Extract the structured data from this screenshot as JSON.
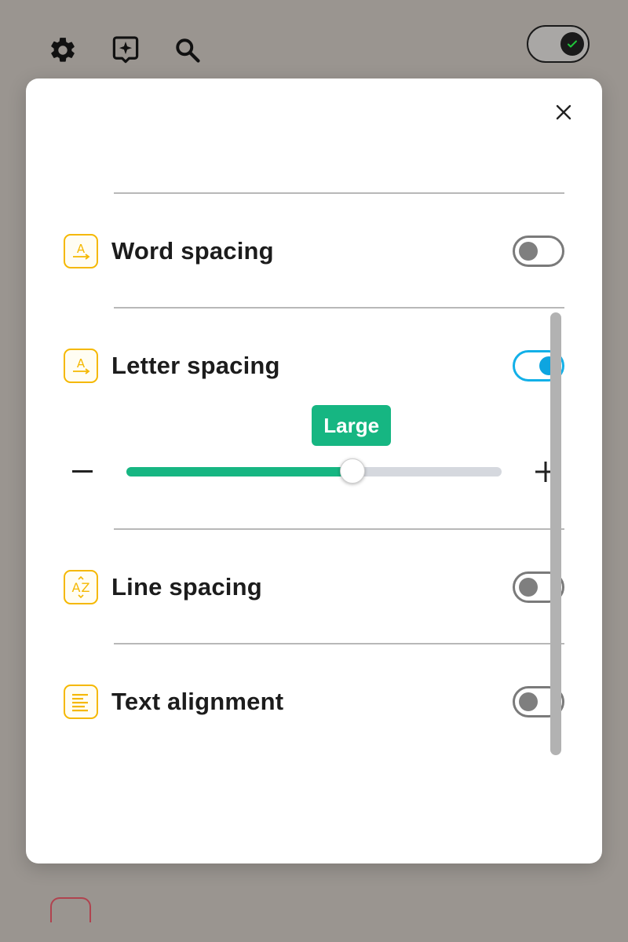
{
  "colors": {
    "overlay": "#9a9590",
    "accent_icon": "#f5b800",
    "toggle_on": "#0ea5e0",
    "slider_fill": "#16b682",
    "tooltip_bg": "#16b682"
  },
  "toolbar": {
    "icons": [
      "gear-icon",
      "ai-sparkle-icon",
      "search-icon"
    ],
    "main_toggle_on": true
  },
  "modal": {
    "close_icon": "close-icon",
    "features": [
      {
        "label": "Word spacing",
        "icon": "text-spacing-icon",
        "enabled": false
      },
      {
        "label": "Letter spacing",
        "icon": "text-spacing-icon",
        "enabled": true
      },
      {
        "label": "Line spacing",
        "icon": "line-height-icon",
        "enabled": false
      },
      {
        "label": "Text alignment",
        "icon": "text-align-icon",
        "enabled": false
      }
    ],
    "letter_spacing_slider": {
      "value_label": "Large",
      "level": 0.6,
      "decrease_icon": "minus-icon",
      "increase_icon": "plus-icon"
    }
  }
}
